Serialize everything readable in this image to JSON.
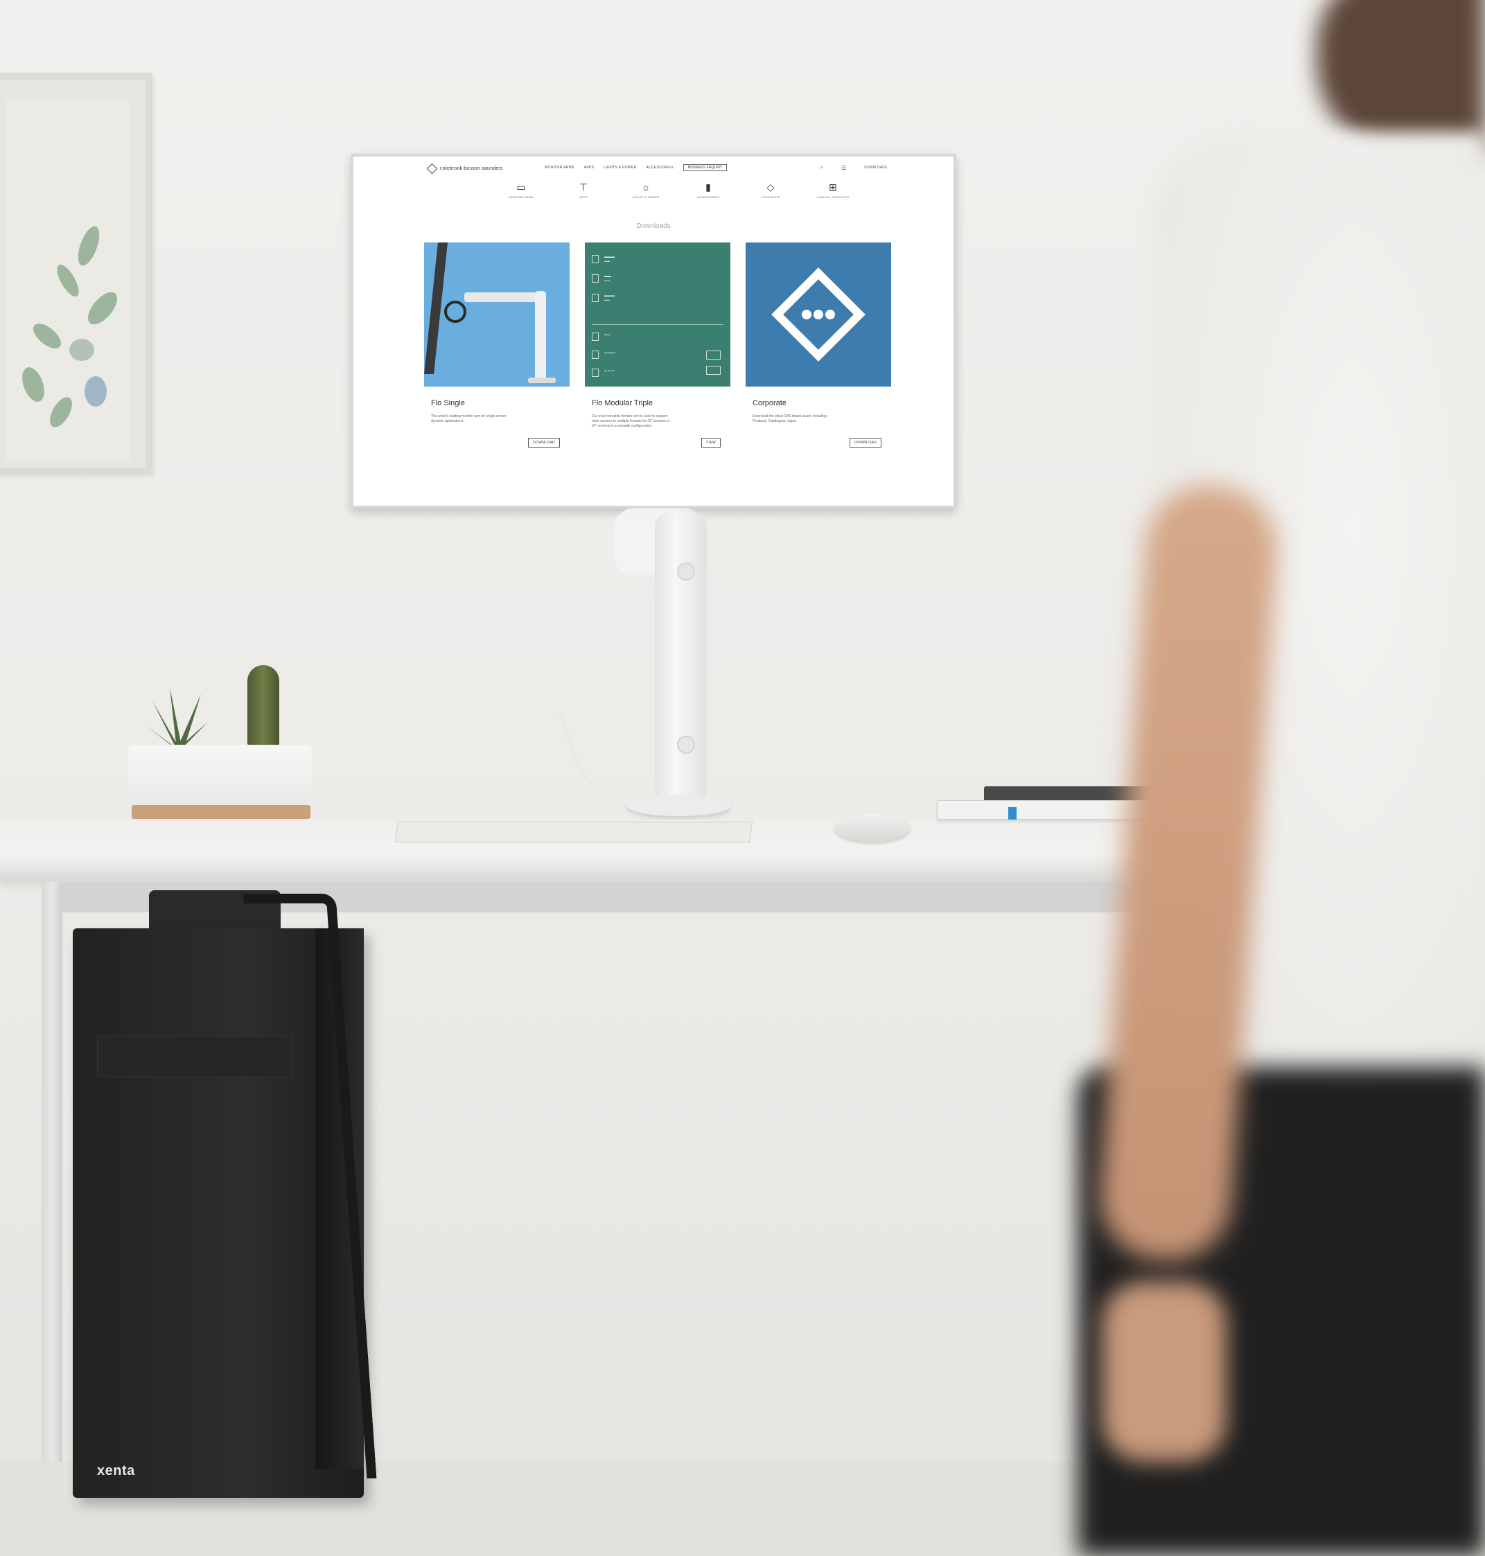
{
  "screen": {
    "nav": {
      "logo_text": "colebrook bosson saunders",
      "links": [
        "MONITOR ARMS",
        "APPS",
        "LIGHTS & POWER",
        "ACCESSORIES"
      ],
      "cta": "BUSINESS ENQUIRY",
      "account": "DOWNLOADS"
    },
    "categories": [
      {
        "label": "MONITOR ARMS",
        "icon": "monitor-icon"
      },
      {
        "label": "APPS",
        "icon": "arm-icon"
      },
      {
        "label": "LIGHTS & POWER",
        "icon": "light-icon"
      },
      {
        "label": "ACCESSORIES",
        "icon": "phone-icon"
      },
      {
        "label": "CORPORATE",
        "icon": "diamond-icon"
      },
      {
        "label": "VIEW ALL PRODUCTS",
        "icon": "grid-icon"
      }
    ],
    "page_title": "Downloads",
    "cards": [
      {
        "title": "Flo Single",
        "description": "The world's leading monitor arm for single screen dynamic applications.",
        "button": "DOWNLOAD"
      },
      {
        "title": "Flo Modular Triple",
        "description": "Our most versatile monitor arm is used to support triple screens in multiple formats for 22\" screens or 24\" screens in a versatile configuration.",
        "button": "VIEW"
      },
      {
        "title": "Corporate",
        "description": "Download the latest CBS brand assets including Products, Catalogues, logos.",
        "button": "DOWNLOAD"
      }
    ]
  },
  "brand_mark": "xenta",
  "colors": {
    "card_blue": "#6aaee0",
    "card_green": "#3b7f70",
    "card_corporate": "#3f7cae",
    "wall": "#ecebe8"
  }
}
